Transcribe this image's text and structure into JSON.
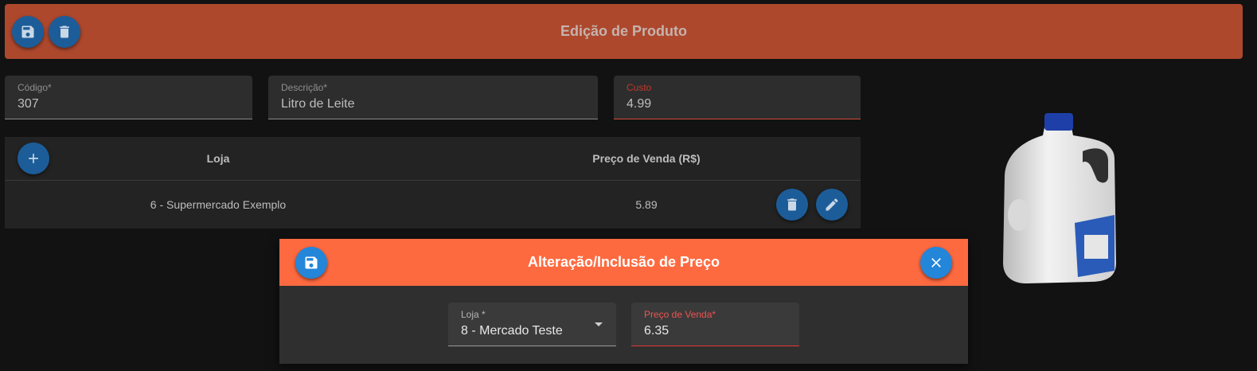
{
  "app": {
    "title": "Edição de Produto",
    "toolbar": {
      "save_icon": "save-icon",
      "delete_icon": "trash-icon"
    }
  },
  "form": {
    "codigo": {
      "label": "Código*",
      "value": "307"
    },
    "descricao": {
      "label": "Descrição*",
      "value": "Litro de Leite"
    },
    "custo": {
      "label": "Custo",
      "value": "4.99"
    }
  },
  "prices_table": {
    "add_icon": "plus-icon",
    "columns": [
      "Loja",
      "Preço de Venda (R$)"
    ],
    "rows": [
      {
        "loja": "6 - Supermercado Exemplo",
        "preco": "5.89",
        "actions": [
          "trash-icon",
          "pencil-icon"
        ]
      }
    ]
  },
  "dialog": {
    "title": "Alteração/Inclusão de Preço",
    "save_icon": "save-icon",
    "close_icon": "close-icon",
    "loja": {
      "label": "Loja *",
      "value": "8 - Mercado Teste"
    },
    "preco": {
      "label": "Preço de Venda*",
      "value": "6.35"
    }
  },
  "colors": {
    "toolbar": "#ad482d",
    "dialog_header": "#fe6a40",
    "fab": "#1c5d99",
    "fab_dialog": "#2486d9",
    "error": "#e53935"
  },
  "product_image": "milk-jug-image"
}
